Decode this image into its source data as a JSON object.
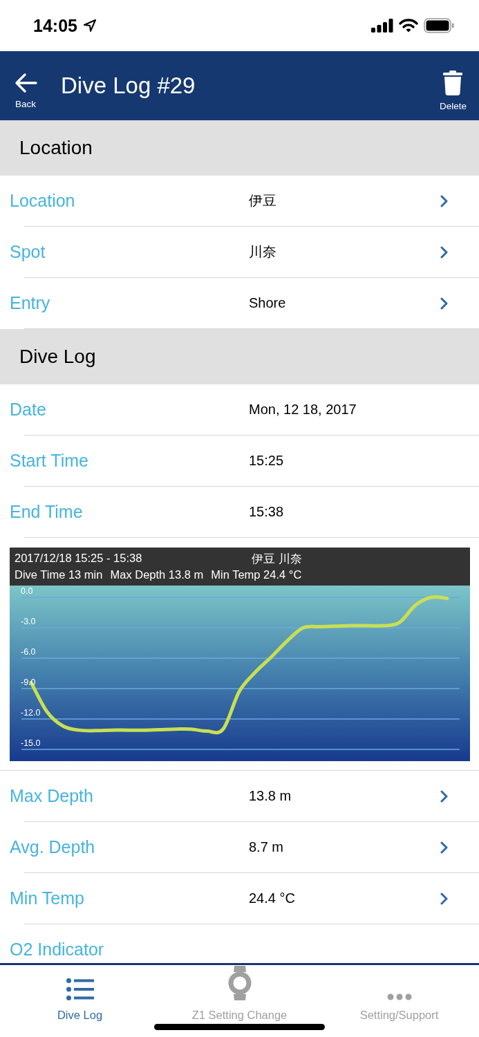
{
  "status_bar": {
    "time": "14:05"
  },
  "nav_bar": {
    "back_label": "Back",
    "title": "Dive Log #29",
    "delete_label": "Delete"
  },
  "sections": [
    {
      "title": "Location",
      "items": [
        {
          "kind": "row",
          "label": "Location",
          "value": "伊豆",
          "chevron": true
        },
        {
          "kind": "row",
          "label": "Spot",
          "value": "川奈",
          "chevron": true
        },
        {
          "kind": "row",
          "label": "Entry",
          "value": "Shore",
          "chevron": true
        }
      ]
    },
    {
      "title": "Dive Log",
      "items": [
        {
          "kind": "row",
          "label": "Date",
          "value": "Mon, 12 18, 2017",
          "chevron": false
        },
        {
          "kind": "row",
          "label": "Start Time",
          "value": "15:25",
          "chevron": false
        },
        {
          "kind": "row",
          "label": "End Time",
          "value": "15:38",
          "chevron": false
        },
        {
          "kind": "chart",
          "period": "2017/12/18 15:25 - 15:38",
          "place": "伊豆 川奈",
          "stats": [
            "Dive Time 13 min",
            "Max Depth 13.8 m",
            "Min Temp 24.4 °C"
          ],
          "chart_data": {
            "type": "line",
            "grid": true,
            "ylim": [
              -15,
              0
            ],
            "yticks": [
              {
                "value": 0,
                "label": "0.0"
              },
              {
                "value": -3,
                "label": "-3.0"
              },
              {
                "value": -6,
                "label": "-6.0"
              },
              {
                "value": -9,
                "label": "-9.0"
              },
              {
                "value": -12,
                "label": "-12.0"
              },
              {
                "value": -15,
                "label": "-15.0"
              }
            ],
            "series": [
              {
                "color": "#c8df52",
                "values": [
                  -8.4,
                  -11.3,
                  -12.7,
                  -13.1,
                  -13.15,
                  -13.1,
                  -13.1,
                  -13.1,
                  -13.05,
                  -13,
                  -13,
                  -13.2,
                  -13,
                  -9.3,
                  -7.4,
                  -5.9,
                  -4.3,
                  -3,
                  -2.9,
                  -2.85,
                  -2.8,
                  -2.8,
                  -2.8,
                  -2.5,
                  -0.8,
                  0,
                  -0.1
                ]
              }
            ]
          }
        },
        {
          "kind": "row",
          "label": "Max Depth",
          "value": "13.8 m",
          "chevron": true
        },
        {
          "kind": "row",
          "label": "Avg. Depth",
          "value": "8.7 m",
          "chevron": true
        },
        {
          "kind": "row",
          "label": "Min Temp",
          "value": "24.4 °C",
          "chevron": true
        },
        {
          "kind": "row",
          "label": "O2 Indicator",
          "chevron": false
        }
      ]
    }
  ],
  "tab_bar": [
    {
      "label": "Dive Log",
      "selected": true
    },
    {
      "label": "Z1 Setting Change",
      "selected": false
    },
    {
      "label": "Setting/Support",
      "selected": false
    }
  ]
}
